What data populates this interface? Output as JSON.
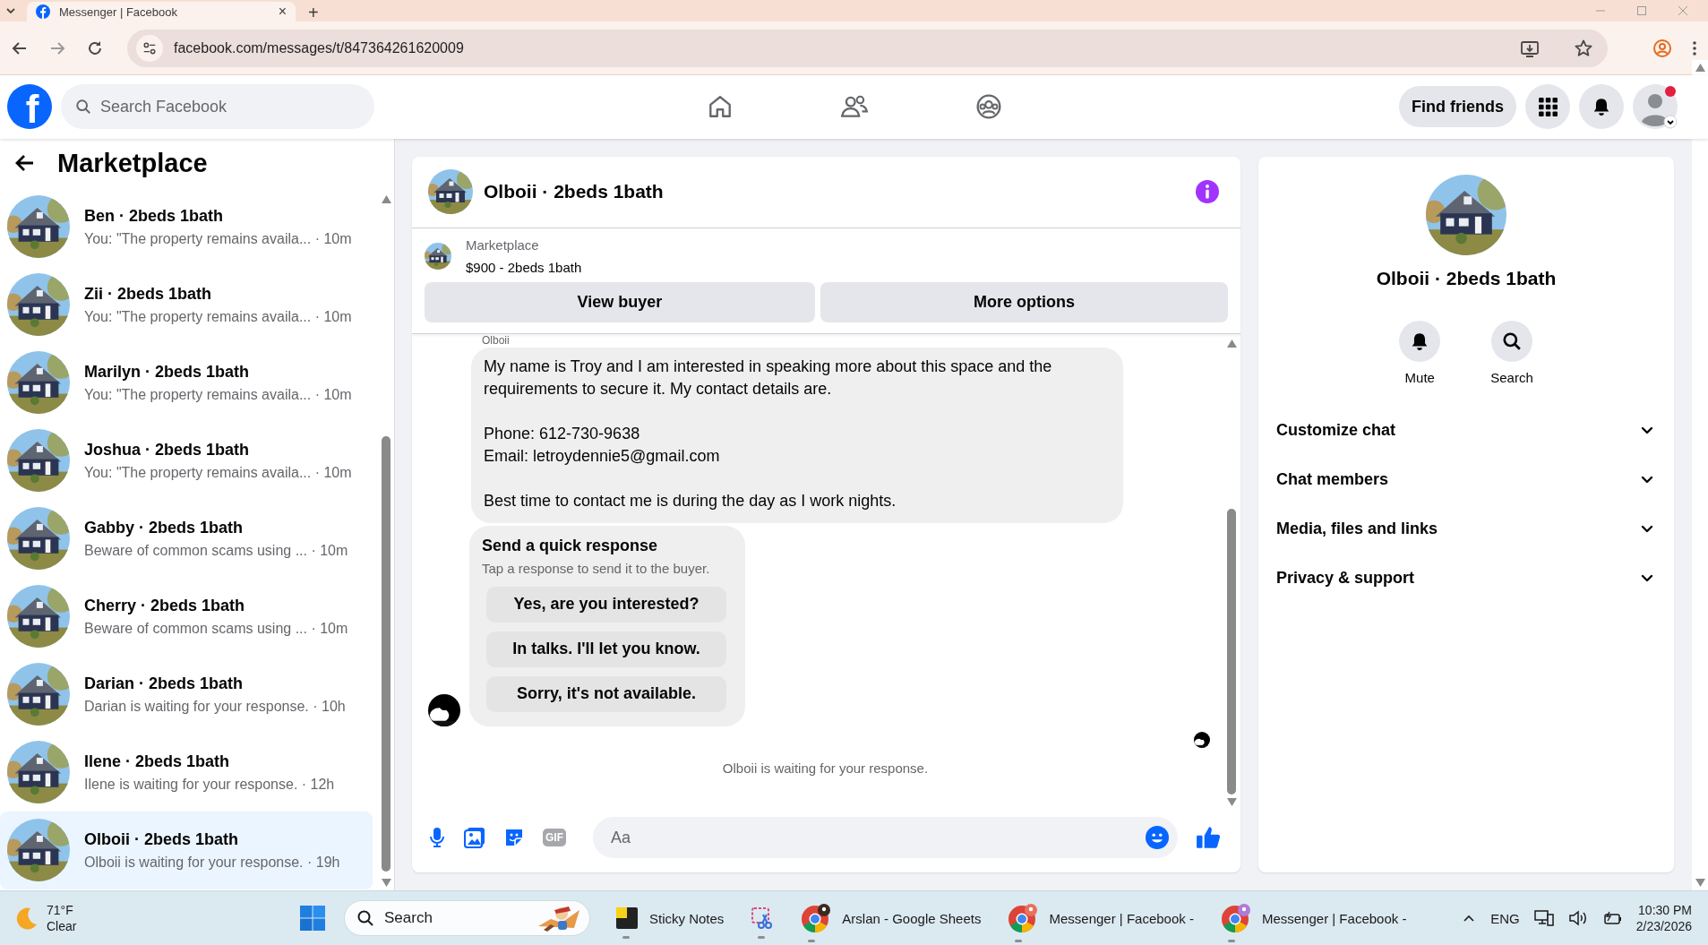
{
  "browser": {
    "tab": {
      "title": "Messenger | Facebook",
      "close": "×"
    },
    "new_tab": "+",
    "url": "facebook.com/messages/t/847364261620009"
  },
  "header": {
    "logo": "f",
    "search": {
      "placeholder": "Search Facebook"
    },
    "nav": [
      {
        "kind": "home",
        "selected": false
      },
      {
        "kind": "friends",
        "selected": false
      },
      {
        "kind": "groups",
        "selected": false
      }
    ],
    "find_friends": "Find friends"
  },
  "sidebar": {
    "title": "Marketplace",
    "conversations": [
      {
        "name": "Ben · 2beds 1bath",
        "preview": "You: \"The property remains availa... · 10m",
        "selected": false
      },
      {
        "name": "Zii · 2beds 1bath",
        "preview": "You: \"The property remains availa... · 10m",
        "selected": false
      },
      {
        "name": "Marilyn · 2beds 1bath",
        "preview": "You: \"The property remains availa... · 10m",
        "selected": false
      },
      {
        "name": "Joshua · 2beds 1bath",
        "preview": "You: \"The property remains availa... · 10m",
        "selected": false
      },
      {
        "name": "Gabby · 2beds 1bath",
        "preview": "Beware of common scams using ... · 10m",
        "selected": false
      },
      {
        "name": "Cherry · 2beds 1bath",
        "preview": "Beware of common scams using ... · 10m",
        "selected": false
      },
      {
        "name": "Darian · 2beds 1bath",
        "preview": "Darian is waiting for your response. · 10h",
        "selected": false
      },
      {
        "name": "Ilene · 2beds 1bath",
        "preview": "Ilene is waiting for your response. · 12h",
        "selected": false
      },
      {
        "name": "Olboii · 2beds 1bath",
        "preview": "Olboii is waiting for your response. · 19h",
        "selected": true
      }
    ]
  },
  "chat": {
    "title": "Olboii · 2beds 1bath",
    "listing": {
      "source": "Marketplace",
      "summary": "$900 - 2beds 1bath"
    },
    "actions": [
      "View buyer",
      "More options"
    ],
    "sender": "Olboii",
    "message": "My name is Troy and I am interested in speaking more about this space and the requirements to secure it. My contact details are.\n\nPhone: 612-730-9638\nEmail: letroydennie5@gmail.com\n\nBest time to contact me is during the day as I work nights.",
    "quick_response": {
      "title": "Send a quick response",
      "hint": "Tap a response to send it to the buyer.",
      "options": [
        "Yes, are you interested?",
        "In talks. I'll let you know.",
        "Sorry, it's not available."
      ]
    },
    "status": "Olboii is waiting for your response.",
    "composer": {
      "gif": "GIF",
      "placeholder": "Aa"
    }
  },
  "details": {
    "name": "Olboii · 2beds 1bath",
    "actions": [
      {
        "kind": "mute",
        "label": "Mute"
      },
      {
        "kind": "search",
        "label": "Search"
      }
    ],
    "sections": [
      {
        "label": "Customize chat",
        "expanded": false
      },
      {
        "label": "Chat members",
        "expanded": false
      },
      {
        "label": "Media, files and links",
        "expanded": false
      },
      {
        "label": "Privacy & support",
        "expanded": false
      }
    ]
  },
  "taskbar": {
    "weather": {
      "temperature": "71°F",
      "condition": "Clear"
    },
    "search": {
      "placeholder": "Search"
    },
    "apps": [
      {
        "kind": "sticky",
        "label": "Sticky Notes"
      },
      {
        "kind": "snip"
      },
      {
        "kind": "chrome",
        "label": "Arslan - Google Sheets"
      },
      {
        "kind": "chrome",
        "label": "Messenger | Facebook -"
      },
      {
        "kind": "chrome",
        "label": "Messenger | Facebook -"
      }
    ],
    "language": "ENG",
    "time": "10:30 PM",
    "date": "2/23/2026"
  }
}
